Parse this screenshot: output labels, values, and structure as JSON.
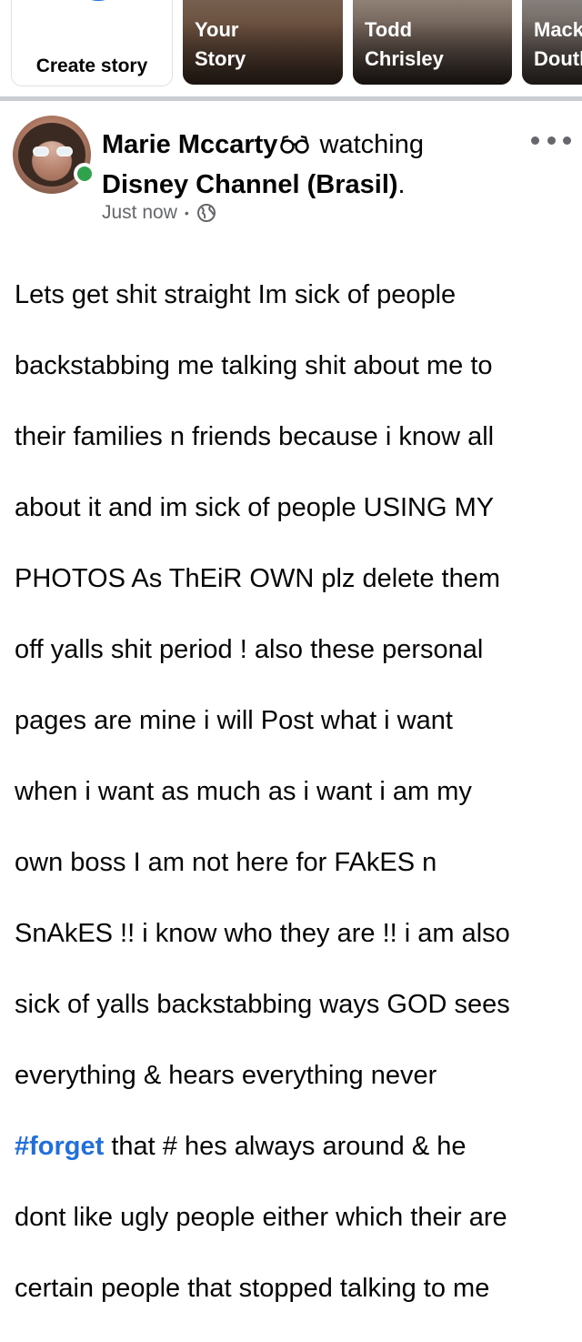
{
  "stories": {
    "create_label": "Create story",
    "items": [
      {
        "name_line1": "Your",
        "name_line2": "Story"
      },
      {
        "name_line1": "Todd",
        "name_line2": "Chrisley"
      },
      {
        "name_line1": "Mack",
        "name_line2": "Doutl"
      }
    ]
  },
  "post": {
    "author": "Marie Mccarty",
    "activity": "watching",
    "page": "Disney Channel (Brasil)",
    "period": ".",
    "timestamp": "Just now",
    "separator": "•",
    "privacy_icon": "globe-icon",
    "more_icon": "more-options-icon",
    "activity_icon": "glasses-icon",
    "body_lines": [
      "Lets get shit straight Im sick of people",
      "backstabbing me talking shit about me to",
      "their families n friends because i know all",
      "about it and im sick of people USING MY",
      "PHOTOS As ThEiR OWN plz delete them",
      "off yalls shit period ! also these personal",
      "pages are mine i will Post what i want",
      "when i want  as much as i want i am my",
      "own boss I am not here for FAkES n",
      "SnAkES !! i know who they are !!  i am also",
      "sick of yalls backstabbing ways GOD sees",
      "everything & hears everything never"
    ],
    "hashtag_line": {
      "hashtag": "#forget",
      "rest": " that #  hes always around & he"
    },
    "body_lines_after": [
      "dont like ugly people either which their are",
      "certain people that stopped talking to me"
    ]
  },
  "colors": {
    "accent": "#1b74e4",
    "online": "#31a24c",
    "hashtag": "#216fdb",
    "muted": "#65676b"
  }
}
